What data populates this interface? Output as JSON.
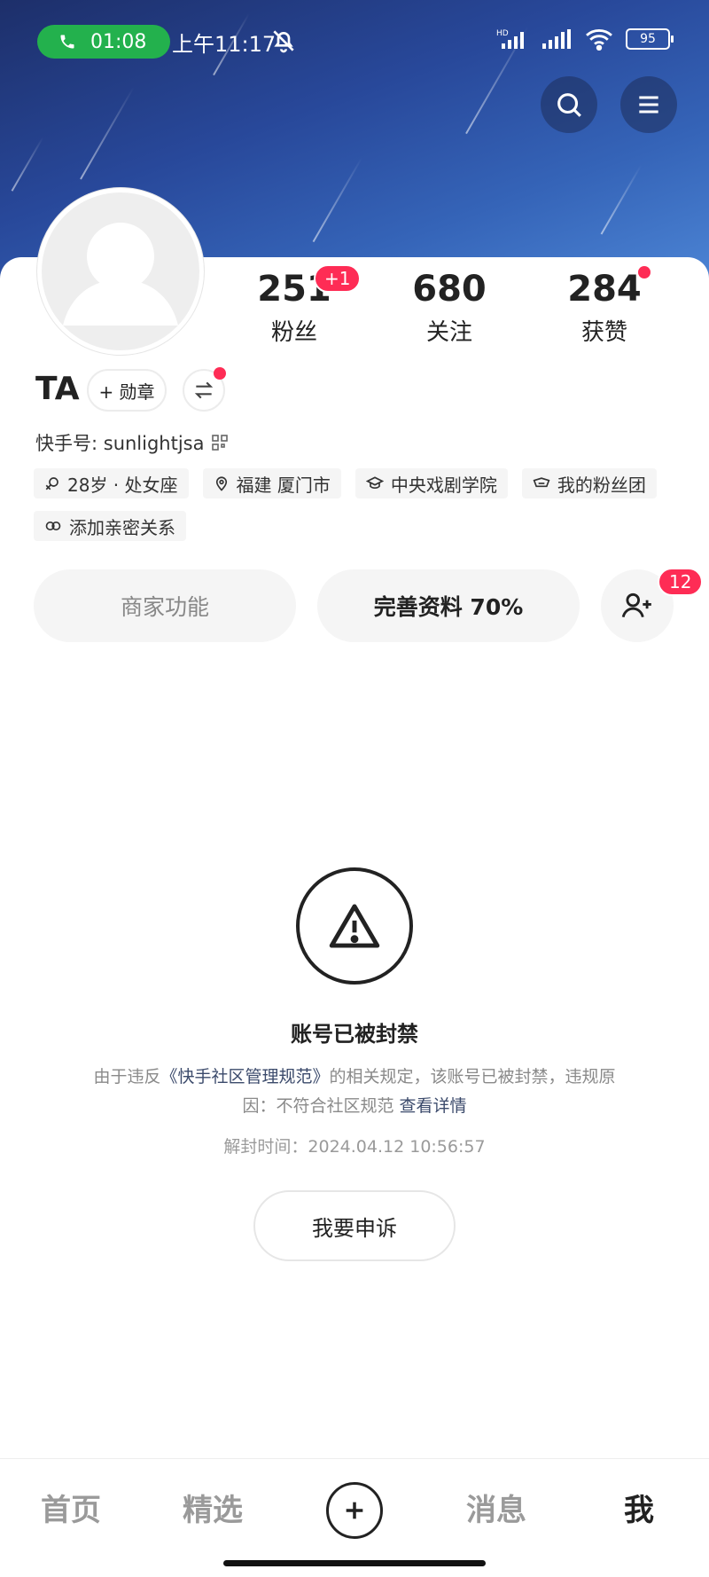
{
  "status_bar": {
    "call_duration": "01:08",
    "time": "上午11:17",
    "battery": "95",
    "icons": [
      "phone-icon",
      "bell-off-icon",
      "hd-signal-icon",
      "signal-icon",
      "wifi-icon",
      "battery-icon"
    ]
  },
  "header": {
    "icons": [
      "search-icon",
      "menu-icon"
    ]
  },
  "profile": {
    "stats": [
      {
        "value": "251",
        "label": "粉丝"
      },
      {
        "value": "680",
        "label": "关注"
      },
      {
        "value": "284",
        "label": "获赞"
      }
    ],
    "fans_badge": "+1",
    "name": "TA",
    "medal_button": "+ 勋章",
    "ks_id": "快手号: sunlightjsa",
    "tags": [
      {
        "icon": "gender-icon",
        "text": "28岁 · 处女座"
      },
      {
        "icon": "location-icon",
        "text": "福建 厦门市"
      },
      {
        "icon": "school-icon",
        "text": "中央戏剧学院"
      },
      {
        "icon": "fan-group-icon",
        "text": "我的粉丝团"
      },
      {
        "icon": "link-icon",
        "text": "添加亲密关系"
      }
    ],
    "merchant_button": "商家功能",
    "complete_button": "完善资料 70%",
    "friend_badge": "12"
  },
  "ban_notice": {
    "title": "账号已被封禁",
    "desc_prefix": "由于违反",
    "rules_link": "《快手社区管理规范》",
    "desc_suffix": "的相关规定，该账号已被封禁，违规原因：不符合社区规范",
    "details_link": "查看详情",
    "unban_time": "解封时间：2024.04.12 10:56:57",
    "appeal_button": "我要申诉"
  },
  "bottom_nav": {
    "items": [
      "首页",
      "精选",
      "消息",
      "我"
    ],
    "active": "我"
  },
  "colors": {
    "accent_red": "#fe2c55",
    "call_green": "#23b14d",
    "banner_blue": "#28489a"
  }
}
